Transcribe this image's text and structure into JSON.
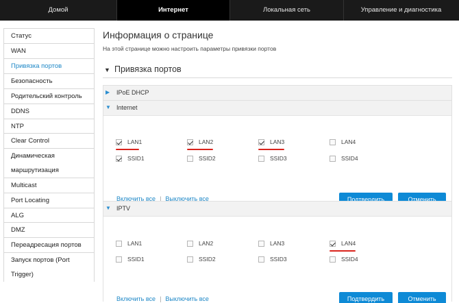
{
  "topnav": {
    "tabs": [
      {
        "label": "Домой"
      },
      {
        "label": "Интернет"
      },
      {
        "label": "Локальная сеть"
      },
      {
        "label": "Управление и диагностика"
      }
    ]
  },
  "sidebar": {
    "items": [
      {
        "label": "Статус"
      },
      {
        "label": "WAN"
      },
      {
        "label": "Привязка портов"
      },
      {
        "label": "Безопасность"
      },
      {
        "label": "Родительский контроль"
      },
      {
        "label": "DDNS"
      },
      {
        "label": "NTP"
      },
      {
        "label": "Clear Control"
      },
      {
        "label": "Динамическая маршрутизация"
      },
      {
        "label": "Multicast"
      },
      {
        "label": "Port Locating"
      },
      {
        "label": "ALG"
      },
      {
        "label": "DMZ"
      },
      {
        "label": "Переадресация портов"
      },
      {
        "label": "Запуск портов (Port Trigger)"
      }
    ]
  },
  "main": {
    "title": "Информация о странице",
    "description": "На этой странице можно настроить параметры привязки портов",
    "section_title": "Привязка портов",
    "panels": [
      {
        "label": "IPoE DHCP",
        "expanded": false
      },
      {
        "label": "Internet",
        "expanded": true,
        "ports": [
          {
            "label": "LAN1",
            "checked": true
          },
          {
            "label": "LAN2",
            "checked": true
          },
          {
            "label": "LAN3",
            "checked": true
          },
          {
            "label": "LAN4",
            "checked": false
          },
          {
            "label": "SSID1",
            "checked": true
          },
          {
            "label": "SSID2",
            "checked": false
          },
          {
            "label": "SSID3",
            "checked": false
          },
          {
            "label": "SSID4",
            "checked": false
          }
        ],
        "select_all": "Включить все",
        "deselect_all": "Выключить все",
        "confirm": "Подтвердить",
        "cancel": "Отменить"
      },
      {
        "label": "IPTV",
        "expanded": true,
        "ports": [
          {
            "label": "LAN1",
            "checked": false
          },
          {
            "label": "LAN2",
            "checked": false
          },
          {
            "label": "LAN3",
            "checked": false
          },
          {
            "label": "LAN4",
            "checked": true
          },
          {
            "label": "SSID1",
            "checked": false
          },
          {
            "label": "SSID2",
            "checked": false
          },
          {
            "label": "SSID3",
            "checked": false
          },
          {
            "label": "SSID4",
            "checked": false
          }
        ],
        "select_all": "Включить все",
        "deselect_all": "Выключить все",
        "confirm": "Подтвердить",
        "cancel": "Отменить"
      }
    ]
  },
  "colors": {
    "accent": "#1f88c7",
    "button": "#0e8ad6",
    "annotation": "#d9231b",
    "nav_bg": "#1a1a1a"
  }
}
